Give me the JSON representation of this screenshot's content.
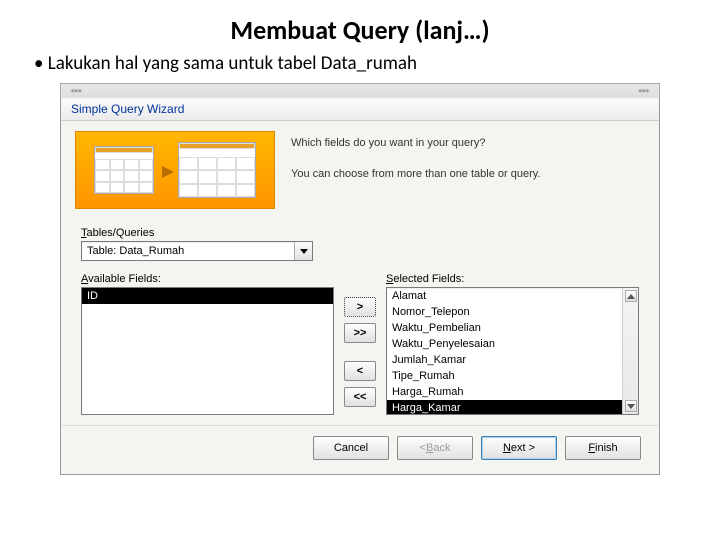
{
  "slide": {
    "title": "Membuat  Query (lanj…)",
    "bullet": "Lakukan hal yang sama untuk tabel  Data_rumah"
  },
  "dialog": {
    "title": "Simple Query Wizard",
    "question": "Which fields do you want in your query?",
    "hint": "You can choose from more than one table or query.",
    "tablesQueriesLabel": "Tables/Queries",
    "tablesQueriesAccess": "T",
    "tableSelected": "Table: Data_Rumah",
    "availableLabel": "Available Fields:",
    "availableAccess": "A",
    "selectedLabel": "Selected Fields:",
    "selectedAccess": "S",
    "available": [
      "ID"
    ],
    "selected": [
      "Alamat",
      "Nomor_Telepon",
      "Waktu_Pembelian",
      "Waktu_Penyelesaian",
      "Jumlah_Kamar",
      "Tipe_Rumah",
      "Harga_Rumah",
      "Harga_Kamar"
    ],
    "move": {
      "add": ">",
      "addAll": ">>",
      "remove": "<",
      "removeAll": "<<"
    },
    "buttons": {
      "cancel": "Cancel",
      "back": "< Back",
      "next": "Next >",
      "finish": "Finish",
      "nextAccess": "N",
      "finishAccess": "F",
      "backAccess": "B"
    }
  }
}
